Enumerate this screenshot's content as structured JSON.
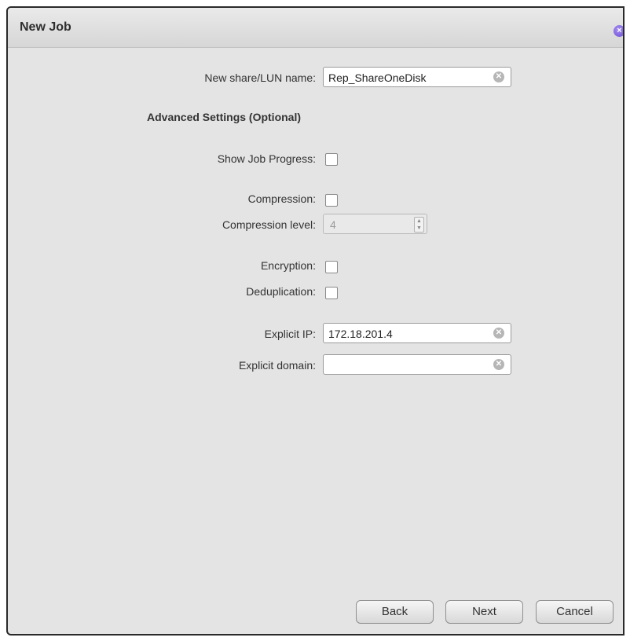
{
  "dialog": {
    "title": "New Job",
    "close_glyph": "×"
  },
  "share_name": {
    "label": "New share/LUN name:",
    "value": "Rep_ShareOneDisk"
  },
  "advanced": {
    "heading": "Advanced Settings (Optional)",
    "show_progress_label": "Show Job Progress:",
    "show_progress_checked": false,
    "compression_label": "Compression:",
    "compression_checked": false,
    "compression_level_label": "Compression level:",
    "compression_level_value": "4",
    "encryption_label": "Encryption:",
    "encryption_checked": false,
    "dedup_label": "Deduplication:",
    "dedup_checked": false
  },
  "network": {
    "explicit_ip_label": "Explicit IP:",
    "explicit_ip_value": "172.18.201.4",
    "explicit_domain_label": "Explicit domain:",
    "explicit_domain_value": ""
  },
  "buttons": {
    "back": "Back",
    "next": "Next",
    "cancel": "Cancel"
  },
  "colors": {
    "dialog_bg": "#e4e4e4",
    "close_accent": "#6a4ed3"
  },
  "icons": {
    "close": "close-icon",
    "clear": "clear-field-icon",
    "spin": "spinner-arrows-icon"
  }
}
